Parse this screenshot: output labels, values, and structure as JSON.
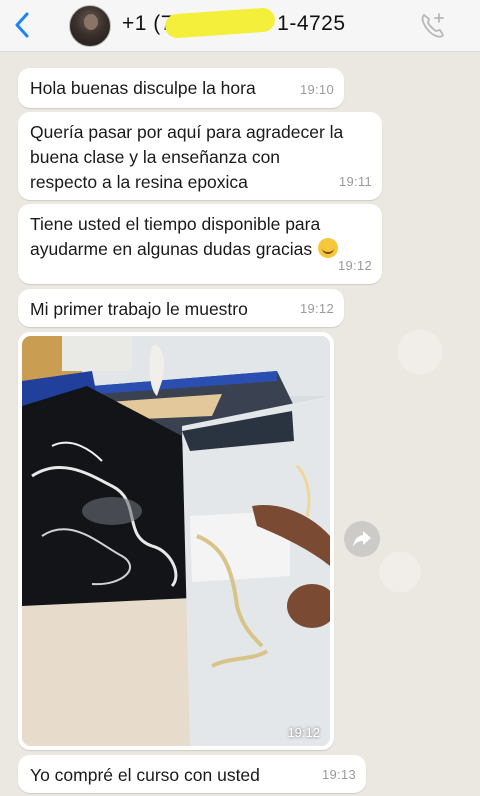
{
  "header": {
    "contact_name": "+1 (78",
    "contact_suffix": "1-4725"
  },
  "messages": [
    {
      "text": "Hola buenas disculpe la hora",
      "time": "19:10"
    },
    {
      "text": "Quería pasar por aquí para agradecer la\nbuena clase y la enseñanza con\nrespecto a la resina epoxica",
      "time": "19:11"
    },
    {
      "text": "Tiene usted el tiempo disponible para\nayudarme en algunas dudas gracias",
      "time": "19:12",
      "emoji": "relieved-face"
    },
    {
      "text": "Mi primer trabajo le muestro",
      "time": "19:12"
    },
    {
      "text": "Yo compré el curso con usted",
      "time": "19:13"
    }
  ],
  "image_message": {
    "time": "19:12"
  },
  "icons": {
    "back": "chevron-left-icon",
    "call": "phone-add-icon",
    "forward": "forward-icon"
  },
  "colors": {
    "accent": "#1a84ff",
    "bubble": "#ffffff",
    "time_text": "#9a9a9a"
  }
}
